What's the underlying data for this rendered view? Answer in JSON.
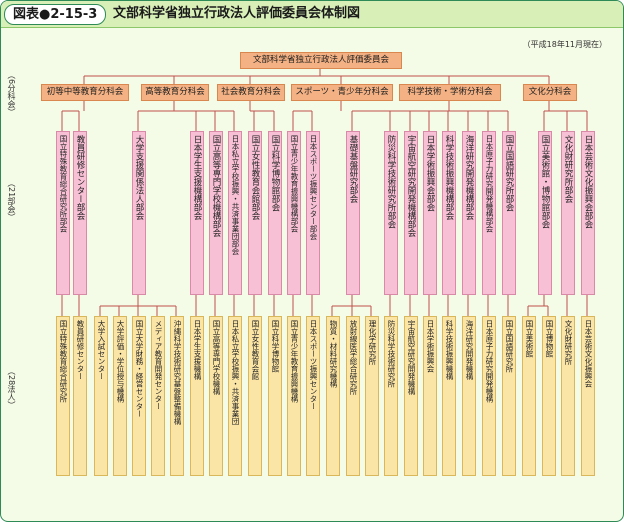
{
  "header": {
    "figure_label": "図表●2-15-3",
    "title": "文部科学省独立行政法人評価委員会体制図"
  },
  "date_note": "（平成18年11月現在）",
  "root": "文部科学省独立行政法人評価委員会",
  "side_labels": {
    "subcommittees": "（6分科会）",
    "bukai": "（21部会）",
    "institutions": "（28法人）"
  },
  "subcommittees": [
    "初等中等教育分科会",
    "高等教育分科会",
    "社会教育分科会",
    "スポーツ・青少年分科会",
    "科学技術・学術分科会",
    "文化分科会"
  ],
  "bukai": [
    "国立特殊教育総合研究所部会",
    "教員研修センター部会",
    "大学支援関係法人部会",
    "日本学生支援機構部会",
    "国立高等専門学校機構部会",
    "日本私立学校振興・共済事業団部会",
    "国立女性教育会館部会",
    "国立科学博物館部会",
    "国立青少年教育振興機構部会",
    "日本スポーツ振興センター部会",
    "基礎基盤研究部会",
    "防災科学技術研究所部会",
    "宇宙航空研究開発機構部会",
    "日本学術振興会部会",
    "科学技術振興機構部会",
    "海洋研究開発機構部会",
    "日本原子力研究開発機構部会",
    "国立国語研究所部会",
    "国立美術館・博物館部会",
    "文化財研究所部会",
    "日本芸術文化振興会部会"
  ],
  "institutions": [
    "国立特殊教育総合研究所",
    "教員研修センター",
    "大学入試センター",
    "大学評価・学位授与機構",
    "国立大学財務・経営センター",
    "メディア教育開発センター",
    "沖縄科学技術研究基盤整備機構",
    "日本学生支援機構",
    "国立高等専門学校機構",
    "日本私立学校振興・共済事業団",
    "国立女性教育会館",
    "国立科学博物館",
    "国立青少年教育振興機構",
    "日本スポーツ振興センター",
    "物質・材料研究機構",
    "放射線医学総合研究所",
    "理化学研究所",
    "防災科学技術研究所",
    "宇宙航空研究開発機構",
    "日本学術振興会",
    "科学技術振興機構",
    "海洋研究開発機構",
    "日本原子力研究開発機構",
    "国立国語研究所",
    "国立美術館",
    "国立博物館",
    "文化財研究所",
    "日本芸術文化振興会"
  ],
  "colors": {
    "subcommittee": "#f4b183",
    "bukai": "#f7c0d5",
    "institution": "#fbe5a6",
    "line": "#c0504d",
    "frame": "#2e8b57"
  }
}
